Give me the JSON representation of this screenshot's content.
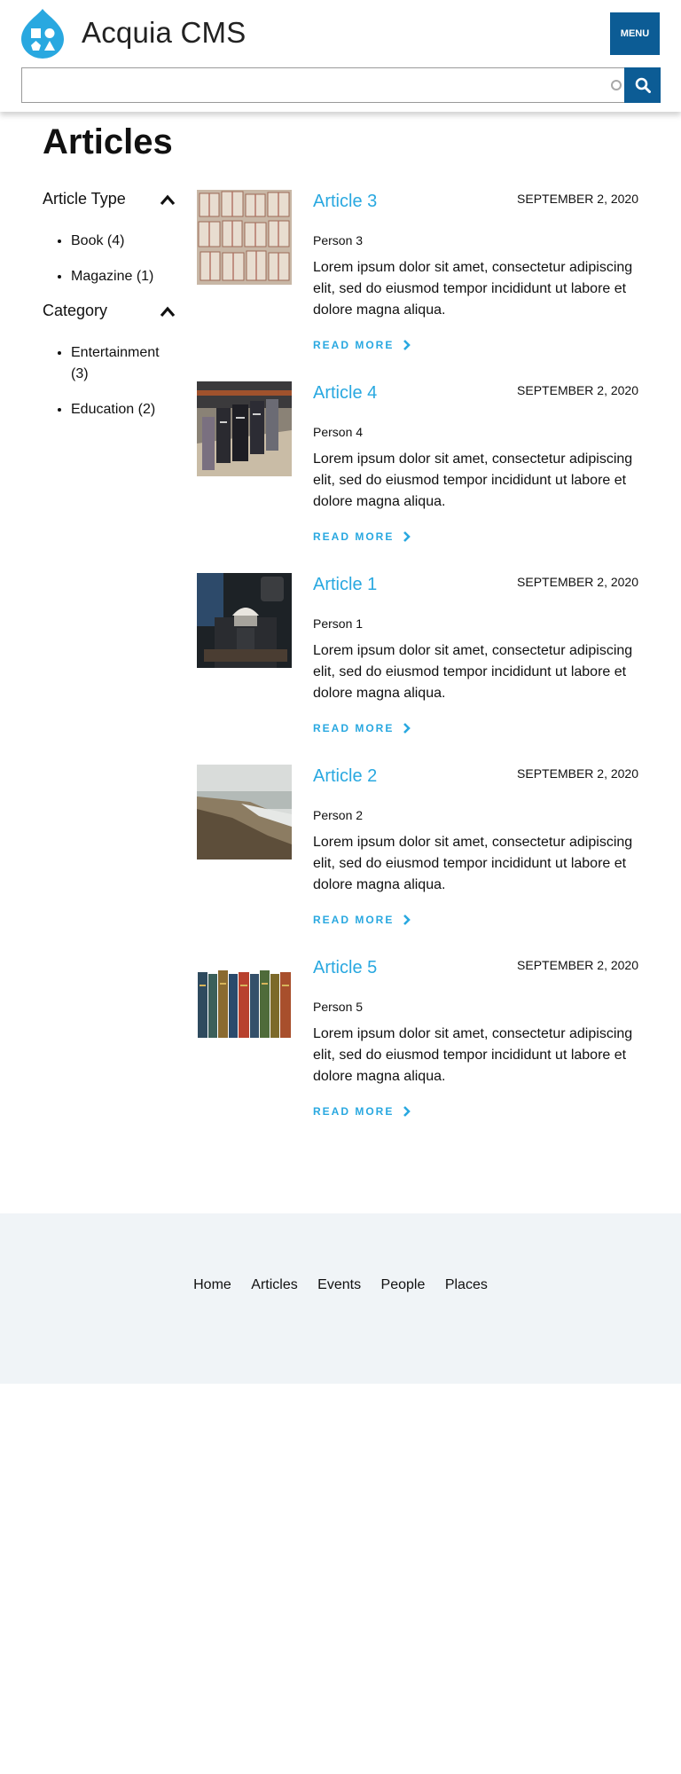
{
  "header": {
    "site_name": "Acquia CMS",
    "menu_label": "MENU",
    "search_value": "",
    "colors": {
      "primary": "#0c5c95",
      "accent": "#29a8e0"
    }
  },
  "page": {
    "title": "Articles"
  },
  "facets": [
    {
      "title": "Article Type",
      "items": [
        "Book (4)",
        "Magazine (1)"
      ]
    },
    {
      "title": "Category",
      "items": [
        "Entertainment (3)",
        "Education (2)"
      ]
    }
  ],
  "articles": [
    {
      "title": "Article 3",
      "date": "SEPTEMBER 2, 2020",
      "author": "Person 3",
      "body": "Lorem ipsum dolor sit amet, consectetur adipiscing elit, sed do eiusmod tempor incididunt ut labore et dolore magna aliqua.",
      "more": "READ MORE"
    },
    {
      "title": "Article 4",
      "date": "SEPTEMBER 2, 2020",
      "author": "Person 4",
      "body": "Lorem ipsum dolor sit amet, consectetur adipiscing elit, sed do eiusmod tempor incididunt ut labore et dolore magna aliqua.",
      "more": "READ MORE"
    },
    {
      "title": "Article 1",
      "date": "SEPTEMBER 2, 2020",
      "author": "Person 1",
      "body": "Lorem ipsum dolor sit amet, consectetur adipiscing elit, sed do eiusmod tempor incididunt ut labore et dolore magna aliqua.",
      "more": "READ MORE"
    },
    {
      "title": "Article 2",
      "date": "SEPTEMBER 2, 2020",
      "author": "Person 2",
      "body": "Lorem ipsum dolor sit amet, consectetur adipiscing elit, sed do eiusmod tempor incididunt ut labore et dolore magna aliqua.",
      "more": "READ MORE"
    },
    {
      "title": "Article 5",
      "date": "SEPTEMBER 2, 2020",
      "author": "Person 5",
      "body": "Lorem ipsum dolor sit amet, consectetur adipiscing elit, sed do eiusmod tempor incididunt ut labore et dolore magna aliqua.",
      "more": "READ MORE"
    }
  ],
  "footer": {
    "nav": [
      "Home",
      "Articles",
      "Events",
      "People",
      "Places"
    ]
  }
}
